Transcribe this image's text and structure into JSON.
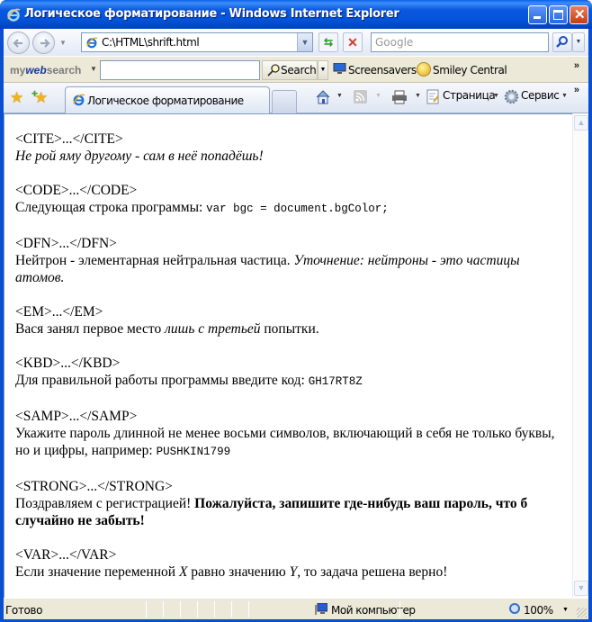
{
  "window": {
    "title": "Логическое форматирование - Windows Internet Explorer",
    "controls": {
      "minimize": "_",
      "maximize": "□",
      "close": "✕"
    }
  },
  "navbar": {
    "address": "C:\\HTML\\shrift.html",
    "search_placeholder": "Google",
    "icons": [
      "back-icon",
      "forward-icon",
      "refresh-icon",
      "stop-icon",
      "search-icon"
    ]
  },
  "toolbar": {
    "brand_prefix": "my",
    "brand_mid": "web",
    "brand_suffix": "search",
    "search_value": "",
    "search_label": "Search",
    "links": [
      {
        "label": "Screensavers",
        "icon": "monitor-icon"
      },
      {
        "label": "Smiley Central",
        "icon": "smiley-icon"
      }
    ],
    "overflow": "»"
  },
  "tabs": {
    "active_label": "Логическое форматирование",
    "commands": {
      "page": "Страница",
      "tools": "Сервис",
      "overflow": "»"
    }
  },
  "content": {
    "sections": [
      {
        "tag": "<CITE>...</CITE>",
        "parts": [
          {
            "text": "Не рой яму другому - сам в неё попадёшь!",
            "style": "italic"
          }
        ]
      },
      {
        "tag": "<CODE>...</CODE>",
        "parts": [
          {
            "text": "Следующая строка программы: ",
            "style": "normal"
          },
          {
            "text": "var bgc = document.bgColor;",
            "style": "mono"
          }
        ]
      },
      {
        "tag": "<DFN>...</DFN>",
        "parts": [
          {
            "text": "Нейтрон - элементарная нейтральная частица. ",
            "style": "normal"
          },
          {
            "text": "Уточнение: нейтроны - это частицы атомов.",
            "style": "italic"
          }
        ]
      },
      {
        "tag": "<EM>...</EM>",
        "parts": [
          {
            "text": "Вася занял первое место ",
            "style": "normal"
          },
          {
            "text": "лишь с третьей",
            "style": "italic"
          },
          {
            "text": " попытки.",
            "style": "normal"
          }
        ]
      },
      {
        "tag": "<KBD>...</KBD>",
        "parts": [
          {
            "text": "Для правильной работы программы введите код: ",
            "style": "normal"
          },
          {
            "text": "GH17RT8Z",
            "style": "mono"
          }
        ]
      },
      {
        "tag": "<SAMP>...</SAMP>",
        "parts": [
          {
            "text": "Укажите пароль длинной не менее восьми символов, включающий в себя не только буквы, но и цифры, например: ",
            "style": "normal"
          },
          {
            "text": "PUSHKIN1799",
            "style": "mono"
          }
        ]
      },
      {
        "tag": "<STRONG>...</STRONG>",
        "parts": [
          {
            "text": "Поздравляем с регистрацией! ",
            "style": "normal"
          },
          {
            "text": "Пожалуйста, запишите где-нибудь ваш пароль, что б случайно не забыть!",
            "style": "bold"
          }
        ]
      },
      {
        "tag": "<VAR>...</VAR>",
        "parts": [
          {
            "text": "Если значение переменной ",
            "style": "normal"
          },
          {
            "text": "X",
            "style": "italic"
          },
          {
            "text": " равно значению ",
            "style": "normal"
          },
          {
            "text": "Y",
            "style": "italic"
          },
          {
            "text": ", то задача решена верно!",
            "style": "normal"
          }
        ]
      }
    ]
  },
  "statusbar": {
    "status": "Готово",
    "zone": "Мой компьютер",
    "zoom": "100%"
  }
}
